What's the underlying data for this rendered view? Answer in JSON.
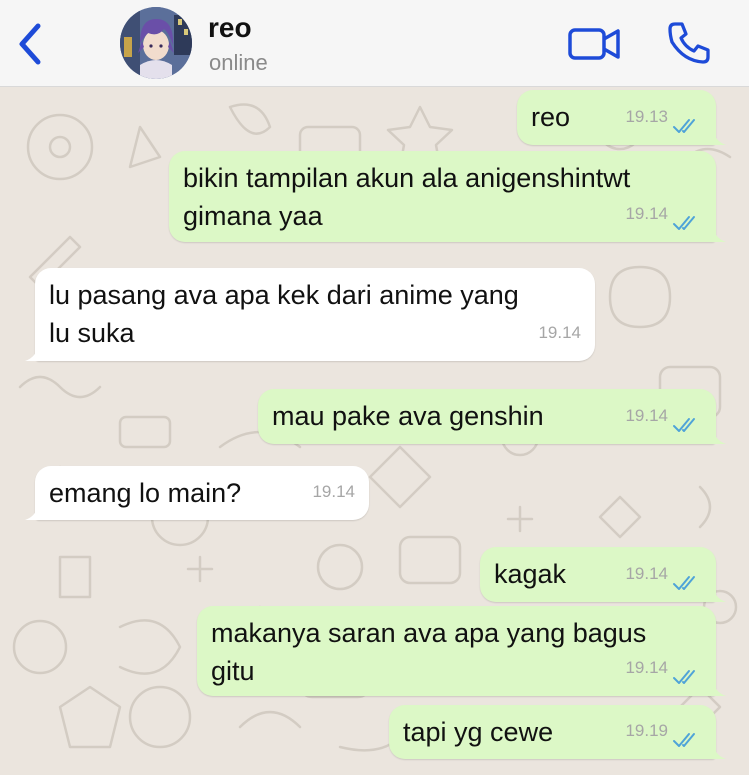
{
  "contact": {
    "name": "reo",
    "status": "online"
  },
  "header": {
    "back_icon": "chevron-left-icon",
    "video_icon": "video-camera-icon",
    "call_icon": "phone-icon",
    "accent_color": "#1e4bd8"
  },
  "colors": {
    "outgoing_bubble": "#dcf8c6",
    "incoming_bubble": "#ffffff",
    "read_ticks": "#4fa3d8",
    "wallpaper": "#ebe5de"
  },
  "messages": [
    {
      "direction": "outgoing",
      "lines": [
        "reo"
      ],
      "time": "19.13",
      "read": true
    },
    {
      "direction": "outgoing",
      "lines": [
        "bikin tampilan akun ala anigenshintwt",
        "gimana yaa"
      ],
      "time": "19.14",
      "read": true
    },
    {
      "direction": "incoming",
      "lines": [
        "lu pasang ava apa kek dari anime yang",
        "lu suka"
      ],
      "time": "19.14"
    },
    {
      "direction": "outgoing",
      "lines": [
        "mau pake ava genshin"
      ],
      "time": "19.14",
      "read": true
    },
    {
      "direction": "incoming",
      "lines": [
        "emang lo main?"
      ],
      "time": "19.14"
    },
    {
      "direction": "outgoing",
      "lines": [
        "kagak"
      ],
      "time": "19.14",
      "read": true
    },
    {
      "direction": "outgoing",
      "lines": [
        "makanya saran ava apa yang bagus",
        "gitu"
      ],
      "time": "19.14",
      "read": true
    },
    {
      "direction": "outgoing",
      "lines": [
        "tapi yg cewe"
      ],
      "time": "19.19",
      "read": true
    }
  ]
}
